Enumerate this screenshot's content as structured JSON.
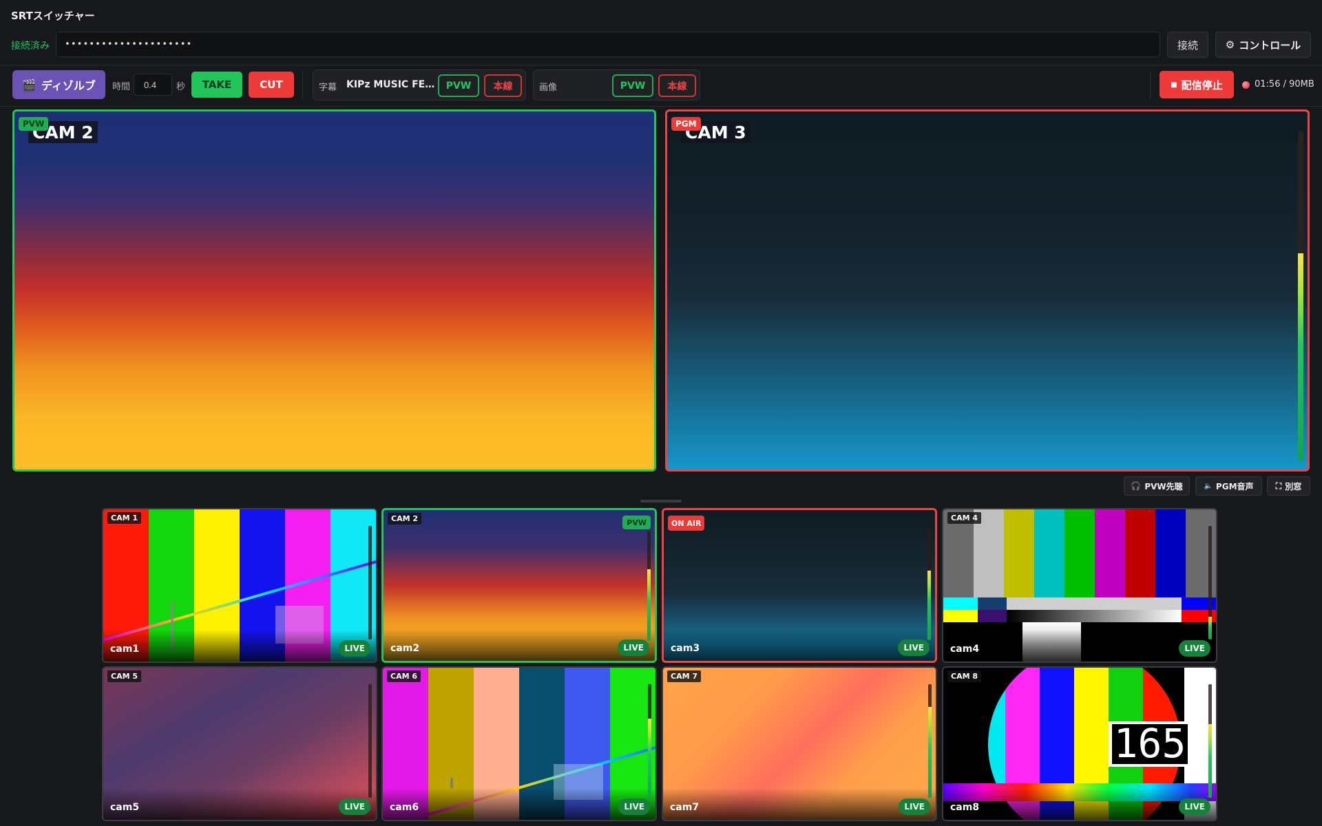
{
  "app": {
    "title": "SRTスイッチャー"
  },
  "connection": {
    "status": "接続済み",
    "url_value": "•••••••••••••••••••••",
    "connect_label": "接続",
    "control_label": "コントロール"
  },
  "toolbar": {
    "dissolve_label": "ディゾルブ",
    "time_label": "時間",
    "time_value": "0.4",
    "seconds_label": "秒",
    "take_label": "TAKE",
    "cut_label": "CUT",
    "caption": {
      "label": "字幕",
      "value": "KIPz MUSIC FE…",
      "pvw_label": "PVW",
      "pgm_label": "本線"
    },
    "image": {
      "label": "画像",
      "value": "",
      "pvw_label": "PVW",
      "pgm_label": "本線"
    },
    "stop_label": "配信停止",
    "recording_text": "01:56 / 90MB"
  },
  "monitors": {
    "preview": {
      "tag": "PVW",
      "camera": "CAM 2"
    },
    "program": {
      "tag": "PGM",
      "camera": "CAM 3",
      "audio_level": 0.63
    }
  },
  "audio_buttons": {
    "pvw_listen": "PVW先聴",
    "pgm_audio": "PGM音声",
    "popout": "別窓"
  },
  "cameras": [
    {
      "tag": "CAM 1",
      "name": "cam1",
      "live": "LIVE",
      "level": 0.0
    },
    {
      "tag": "CAM 2",
      "name": "cam2",
      "live": "LIVE",
      "pvw_tag": "PVW",
      "level": 0.65
    },
    {
      "tag": "ON AIR",
      "name": "cam3",
      "live": "LIVE",
      "level": 0.62
    },
    {
      "tag": "CAM 4",
      "name": "cam4",
      "live": "LIVE",
      "level": 0.2
    },
    {
      "tag": "CAM 5",
      "name": "cam5",
      "live": "LIVE",
      "level": 0.0
    },
    {
      "tag": "CAM 6",
      "name": "cam6",
      "live": "LIVE",
      "level": 0.7
    },
    {
      "tag": "CAM 7",
      "name": "cam7",
      "live": "LIVE",
      "level": 0.8
    },
    {
      "tag": "CAM 8",
      "name": "cam8",
      "live": "LIVE",
      "level": 0.65
    }
  ],
  "colors": {
    "pvw_accent": "#22c55e",
    "pgm_accent": "#ef4444",
    "dissolve": "#6b52b5"
  }
}
